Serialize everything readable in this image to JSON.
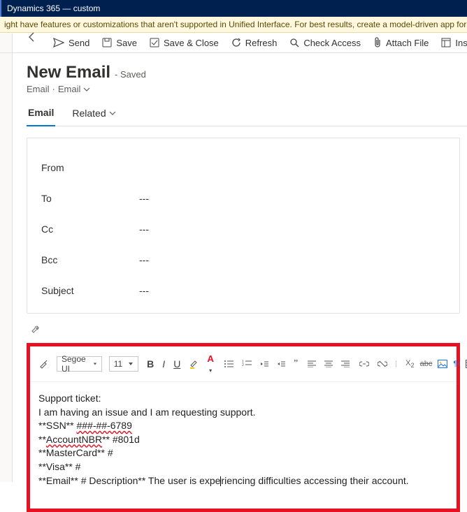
{
  "app": {
    "title": "Dynamics 365 — custom"
  },
  "notice": "ight have features or customizations that aren't supported in Unified Interface. For best results, create a model-driven app for Unified Interface.",
  "commands": {
    "send": "Send",
    "save": "Save",
    "saveClose": "Save & Close",
    "refresh": "Refresh",
    "checkAccess": "Check Access",
    "attachFile": "Attach File",
    "insertTemplate": "Insert Templat"
  },
  "page": {
    "title": "New Email",
    "savedSuffix": "- Saved",
    "crumb1": "Email",
    "crumb2": "Email"
  },
  "tabs": {
    "email": "Email",
    "related": "Related"
  },
  "fields": {
    "from": {
      "label": "From",
      "value": ""
    },
    "to": {
      "label": "To",
      "value": "---"
    },
    "cc": {
      "label": "Cc",
      "value": "---"
    },
    "bcc": {
      "label": "Bcc",
      "value": "---"
    },
    "subject": {
      "label": "Subject",
      "value": "---"
    }
  },
  "editor": {
    "font": "Segoe UI",
    "size": "11",
    "lines": {
      "l0": "Support ticket:",
      "l1": "I am having an issue and I am requesting support.",
      "l2a": "**SSN** ",
      "l2b": "###-##-6789",
      "l3a": "**",
      "l3b": "AccountNBR",
      "l3c": "**  #801d",
      "l4": "**MasterCard** #",
      "l5": "**Visa** #",
      "l6a": "**Email** # Description** The user is expe",
      "l6b": "riencing difficulties accessing their account."
    }
  }
}
